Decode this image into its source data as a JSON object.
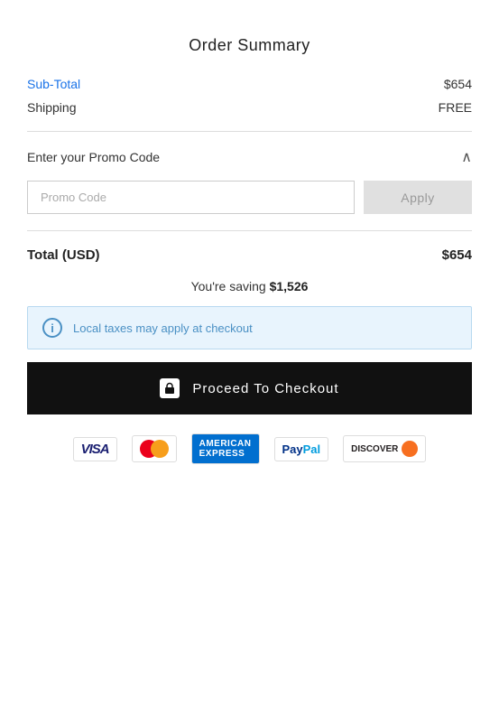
{
  "page": {
    "title": "Order Summary"
  },
  "summary": {
    "subtotal_label": "Sub-Total",
    "subtotal_value": "$654",
    "shipping_label": "Shipping",
    "shipping_value": "FREE"
  },
  "promo": {
    "section_label": "Enter your Promo Code",
    "input_placeholder": "Promo Code",
    "apply_label": "Apply"
  },
  "total": {
    "label": "Total (USD)",
    "value": "$654",
    "saving_prefix": "You're saving ",
    "saving_amount": "$1,526"
  },
  "info_banner": {
    "text": "Local taxes may apply at checkout"
  },
  "checkout": {
    "button_label": "Proceed To Checkout"
  },
  "payment_methods": [
    "VISA",
    "Mastercard",
    "Amex",
    "PayPal",
    "Discover"
  ]
}
